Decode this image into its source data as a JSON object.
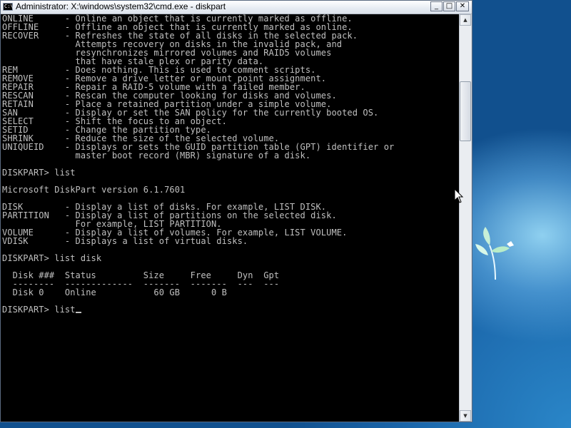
{
  "window": {
    "title": "Administrator: X:\\windows\\system32\\cmd.exe - diskpart",
    "icon_label": "C:\\"
  },
  "controls": {
    "minimize": "_",
    "maximize": "□",
    "close": "✕"
  },
  "console": {
    "lines": [
      "ONLINE      - Online an object that is currently marked as offline.",
      "OFFLINE     - Offline an object that is currently marked as online.",
      "RECOVER     - Refreshes the state of all disks in the selected pack.",
      "              Attempts recovery on disks in the invalid pack, and",
      "              resynchronizes mirrored volumes and RAID5 volumes",
      "              that have stale plex or parity data.",
      "REM         - Does nothing. This is used to comment scripts.",
      "REMOVE      - Remove a drive letter or mount point assignment.",
      "REPAIR      - Repair a RAID-5 volume with a failed member.",
      "RESCAN      - Rescan the computer looking for disks and volumes.",
      "RETAIN      - Place a retained partition under a simple volume.",
      "SAN         - Display or set the SAN policy for the currently booted OS.",
      "SELECT      - Shift the focus to an object.",
      "SETID       - Change the partition type.",
      "SHRINK      - Reduce the size of the selected volume.",
      "UNIQUEID    - Displays or sets the GUID partition table (GPT) identifier or",
      "              master boot record (MBR) signature of a disk.",
      "",
      "DISKPART> list",
      "",
      "Microsoft DiskPart version 6.1.7601",
      "",
      "DISK        - Display a list of disks. For example, LIST DISK.",
      "PARTITION   - Display a list of partitions on the selected disk.",
      "              For example, LIST PARTITION.",
      "VOLUME      - Display a list of volumes. For example, LIST VOLUME.",
      "VDISK       - Displays a list of virtual disks.",
      "",
      "DISKPART> list disk",
      "",
      "  Disk ###  Status         Size     Free     Dyn  Gpt",
      "  --------  -------------  -------  -------  ---  ---",
      "  Disk 0    Online           60 GB      0 B",
      ""
    ],
    "prompt": "DISKPART> ",
    "current_input": "list"
  },
  "scrollbar": {
    "up_arrow": "▲",
    "down_arrow": "▼"
  }
}
